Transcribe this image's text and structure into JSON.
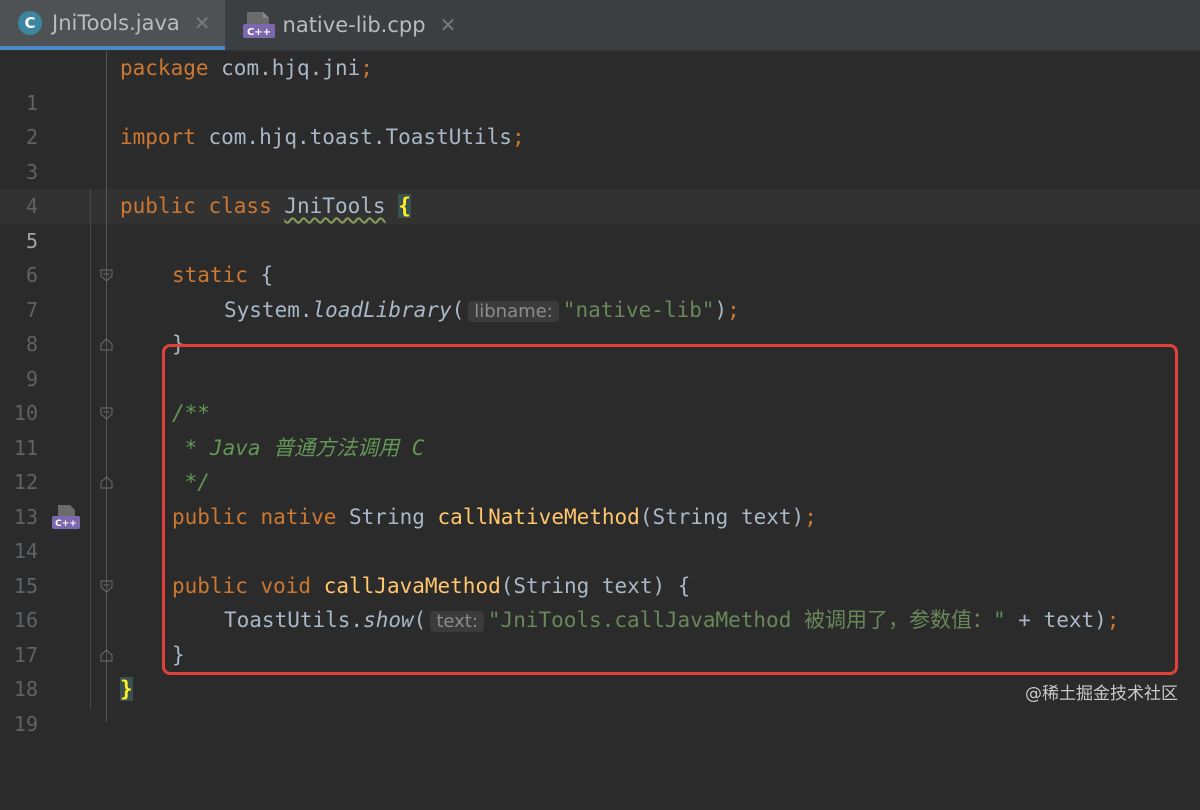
{
  "tabs": [
    {
      "icon": "java-class-icon",
      "icon_glyph": "C",
      "label": "JniTools.java",
      "active": true
    },
    {
      "icon": "cpp-file-icon",
      "icon_glyph": "C++",
      "label": "native-lib.cpp",
      "active": false
    }
  ],
  "close_glyph": "✕",
  "lines": {
    "l1": {
      "kw": "package",
      "rest": " com.hjq.jni",
      "semi": ";"
    },
    "l3": {
      "kw": "import",
      "rest": " com.hjq.toast.ToastUtils",
      "semi": ";"
    },
    "l5": {
      "kw": "public class",
      "sp": " ",
      "cls": "JniTools",
      "sp2": " ",
      "brace": "{"
    },
    "l7": {
      "kw": "static",
      "rest": " {"
    },
    "l8": {
      "obj": "System.",
      "method": "loadLibrary",
      "open": "(",
      "hint": "libname:",
      "str": "\"native-lib\"",
      "close": ")",
      "semi": ";"
    },
    "l9": {
      "rest": "}"
    },
    "l11": {
      "doc": "/**"
    },
    "l12": {
      "doc": " * Java 普通方法调用 C"
    },
    "l13": {
      "doc": " */"
    },
    "l14": {
      "kw": "public native",
      "type": " String ",
      "fn": "callNativeMethod",
      "rest": "(String text)",
      "semi": ";"
    },
    "l16": {
      "kw": "public void",
      "sp": " ",
      "fn": "callJavaMethod",
      "rest": "(String text) {"
    },
    "l17": {
      "obj": "ToastUtils.",
      "method": "show",
      "open": "(",
      "hint": "text:",
      "str": "\"JniTools.callJavaMethod 被调用了，参数值：\"",
      "rest": " + text)",
      "semi": ";"
    },
    "l18": {
      "rest": "}"
    },
    "l19": {
      "brace": "}"
    }
  },
  "line_numbers": [
    "1",
    "2",
    "3",
    "4",
    "5",
    "6",
    "7",
    "8",
    "9",
    "10",
    "11",
    "12",
    "13",
    "14",
    "15",
    "16",
    "17",
    "18",
    "19"
  ],
  "watermark": "@稀土掘金技术社区",
  "colors": {
    "keyword": "#cc7832",
    "string": "#6a8759",
    "function": "#ffc66d",
    "doc_comment": "#629755",
    "highlight_box": "#e0413b"
  }
}
